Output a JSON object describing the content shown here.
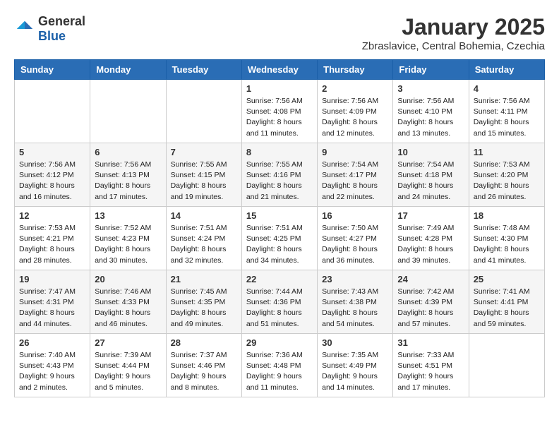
{
  "header": {
    "logo_general": "General",
    "logo_blue": "Blue",
    "month_title": "January 2025",
    "location": "Zbraslavice, Central Bohemia, Czechia"
  },
  "days_of_week": [
    "Sunday",
    "Monday",
    "Tuesday",
    "Wednesday",
    "Thursday",
    "Friday",
    "Saturday"
  ],
  "weeks": [
    [
      {
        "day": "",
        "info": ""
      },
      {
        "day": "",
        "info": ""
      },
      {
        "day": "",
        "info": ""
      },
      {
        "day": "1",
        "info": "Sunrise: 7:56 AM\nSunset: 4:08 PM\nDaylight: 8 hours\nand 11 minutes."
      },
      {
        "day": "2",
        "info": "Sunrise: 7:56 AM\nSunset: 4:09 PM\nDaylight: 8 hours\nand 12 minutes."
      },
      {
        "day": "3",
        "info": "Sunrise: 7:56 AM\nSunset: 4:10 PM\nDaylight: 8 hours\nand 13 minutes."
      },
      {
        "day": "4",
        "info": "Sunrise: 7:56 AM\nSunset: 4:11 PM\nDaylight: 8 hours\nand 15 minutes."
      }
    ],
    [
      {
        "day": "5",
        "info": "Sunrise: 7:56 AM\nSunset: 4:12 PM\nDaylight: 8 hours\nand 16 minutes."
      },
      {
        "day": "6",
        "info": "Sunrise: 7:56 AM\nSunset: 4:13 PM\nDaylight: 8 hours\nand 17 minutes."
      },
      {
        "day": "7",
        "info": "Sunrise: 7:55 AM\nSunset: 4:15 PM\nDaylight: 8 hours\nand 19 minutes."
      },
      {
        "day": "8",
        "info": "Sunrise: 7:55 AM\nSunset: 4:16 PM\nDaylight: 8 hours\nand 21 minutes."
      },
      {
        "day": "9",
        "info": "Sunrise: 7:54 AM\nSunset: 4:17 PM\nDaylight: 8 hours\nand 22 minutes."
      },
      {
        "day": "10",
        "info": "Sunrise: 7:54 AM\nSunset: 4:18 PM\nDaylight: 8 hours\nand 24 minutes."
      },
      {
        "day": "11",
        "info": "Sunrise: 7:53 AM\nSunset: 4:20 PM\nDaylight: 8 hours\nand 26 minutes."
      }
    ],
    [
      {
        "day": "12",
        "info": "Sunrise: 7:53 AM\nSunset: 4:21 PM\nDaylight: 8 hours\nand 28 minutes."
      },
      {
        "day": "13",
        "info": "Sunrise: 7:52 AM\nSunset: 4:23 PM\nDaylight: 8 hours\nand 30 minutes."
      },
      {
        "day": "14",
        "info": "Sunrise: 7:51 AM\nSunset: 4:24 PM\nDaylight: 8 hours\nand 32 minutes."
      },
      {
        "day": "15",
        "info": "Sunrise: 7:51 AM\nSunset: 4:25 PM\nDaylight: 8 hours\nand 34 minutes."
      },
      {
        "day": "16",
        "info": "Sunrise: 7:50 AM\nSunset: 4:27 PM\nDaylight: 8 hours\nand 36 minutes."
      },
      {
        "day": "17",
        "info": "Sunrise: 7:49 AM\nSunset: 4:28 PM\nDaylight: 8 hours\nand 39 minutes."
      },
      {
        "day": "18",
        "info": "Sunrise: 7:48 AM\nSunset: 4:30 PM\nDaylight: 8 hours\nand 41 minutes."
      }
    ],
    [
      {
        "day": "19",
        "info": "Sunrise: 7:47 AM\nSunset: 4:31 PM\nDaylight: 8 hours\nand 44 minutes."
      },
      {
        "day": "20",
        "info": "Sunrise: 7:46 AM\nSunset: 4:33 PM\nDaylight: 8 hours\nand 46 minutes."
      },
      {
        "day": "21",
        "info": "Sunrise: 7:45 AM\nSunset: 4:35 PM\nDaylight: 8 hours\nand 49 minutes."
      },
      {
        "day": "22",
        "info": "Sunrise: 7:44 AM\nSunset: 4:36 PM\nDaylight: 8 hours\nand 51 minutes."
      },
      {
        "day": "23",
        "info": "Sunrise: 7:43 AM\nSunset: 4:38 PM\nDaylight: 8 hours\nand 54 minutes."
      },
      {
        "day": "24",
        "info": "Sunrise: 7:42 AM\nSunset: 4:39 PM\nDaylight: 8 hours\nand 57 minutes."
      },
      {
        "day": "25",
        "info": "Sunrise: 7:41 AM\nSunset: 4:41 PM\nDaylight: 8 hours\nand 59 minutes."
      }
    ],
    [
      {
        "day": "26",
        "info": "Sunrise: 7:40 AM\nSunset: 4:43 PM\nDaylight: 9 hours\nand 2 minutes."
      },
      {
        "day": "27",
        "info": "Sunrise: 7:39 AM\nSunset: 4:44 PM\nDaylight: 9 hours\nand 5 minutes."
      },
      {
        "day": "28",
        "info": "Sunrise: 7:37 AM\nSunset: 4:46 PM\nDaylight: 9 hours\nand 8 minutes."
      },
      {
        "day": "29",
        "info": "Sunrise: 7:36 AM\nSunset: 4:48 PM\nDaylight: 9 hours\nand 11 minutes."
      },
      {
        "day": "30",
        "info": "Sunrise: 7:35 AM\nSunset: 4:49 PM\nDaylight: 9 hours\nand 14 minutes."
      },
      {
        "day": "31",
        "info": "Sunrise: 7:33 AM\nSunset: 4:51 PM\nDaylight: 9 hours\nand 17 minutes."
      },
      {
        "day": "",
        "info": ""
      }
    ]
  ]
}
